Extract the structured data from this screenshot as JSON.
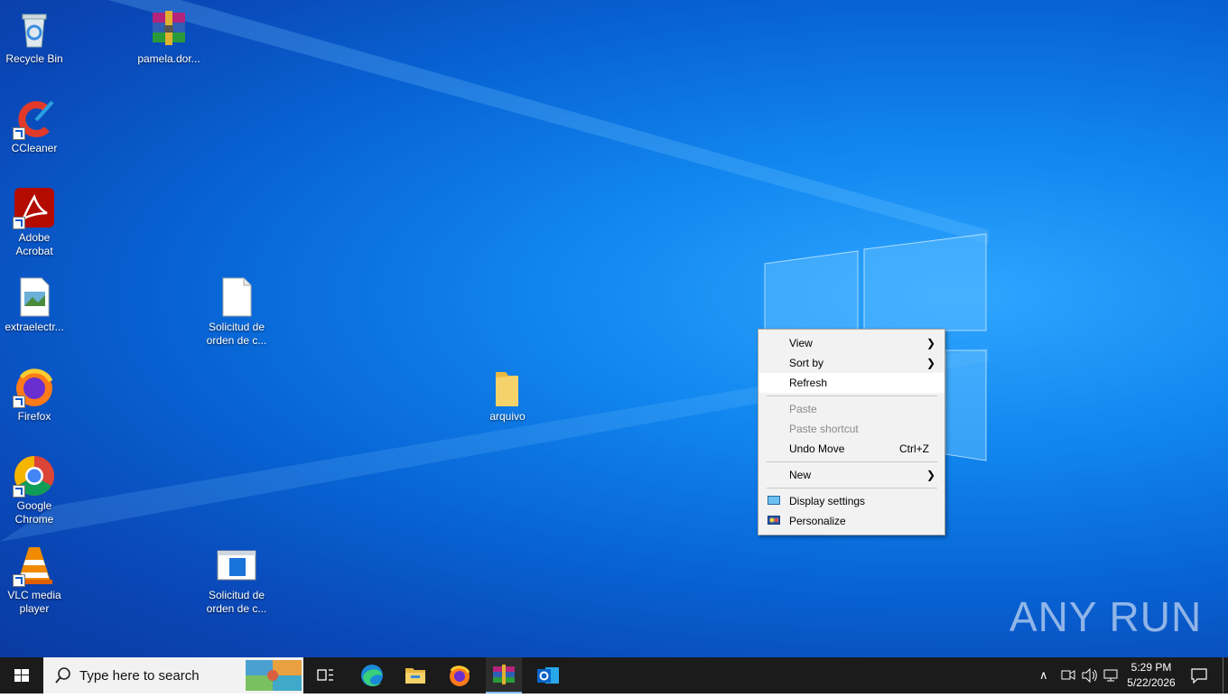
{
  "desktop": {
    "icons": [
      {
        "label": "Recycle Bin"
      },
      {
        "label": "pamela.dor..."
      },
      {
        "label": "CCleaner"
      },
      {
        "label": "Adobe Acrobat"
      },
      {
        "label": "extraelectr..."
      },
      {
        "label": "Solicitud de orden de c..."
      },
      {
        "label": "arquivo"
      },
      {
        "label": "Firefox"
      },
      {
        "label": "Google Chrome"
      },
      {
        "label": "VLC media player"
      },
      {
        "label": "Solicitud de orden de c..."
      }
    ],
    "watermark": "ANY RUN"
  },
  "context_menu": {
    "items": [
      {
        "label": "View"
      },
      {
        "label": "Sort by"
      },
      {
        "label": "Refresh"
      },
      {
        "label": "Paste"
      },
      {
        "label": "Paste shortcut"
      },
      {
        "label": "Undo Move",
        "shortcut": "Ctrl+Z"
      },
      {
        "label": "New"
      },
      {
        "label": "Display settings"
      },
      {
        "label": "Personalize"
      }
    ]
  },
  "taskbar": {
    "search_placeholder": "Type here to search",
    "time": "5:29 PM",
    "date": "5/22/2026"
  },
  "colors": {
    "taskbar_bg": "#1b1b1b",
    "menu_bg": "#f2f2f2",
    "desktop_blue": "#0866d6"
  }
}
